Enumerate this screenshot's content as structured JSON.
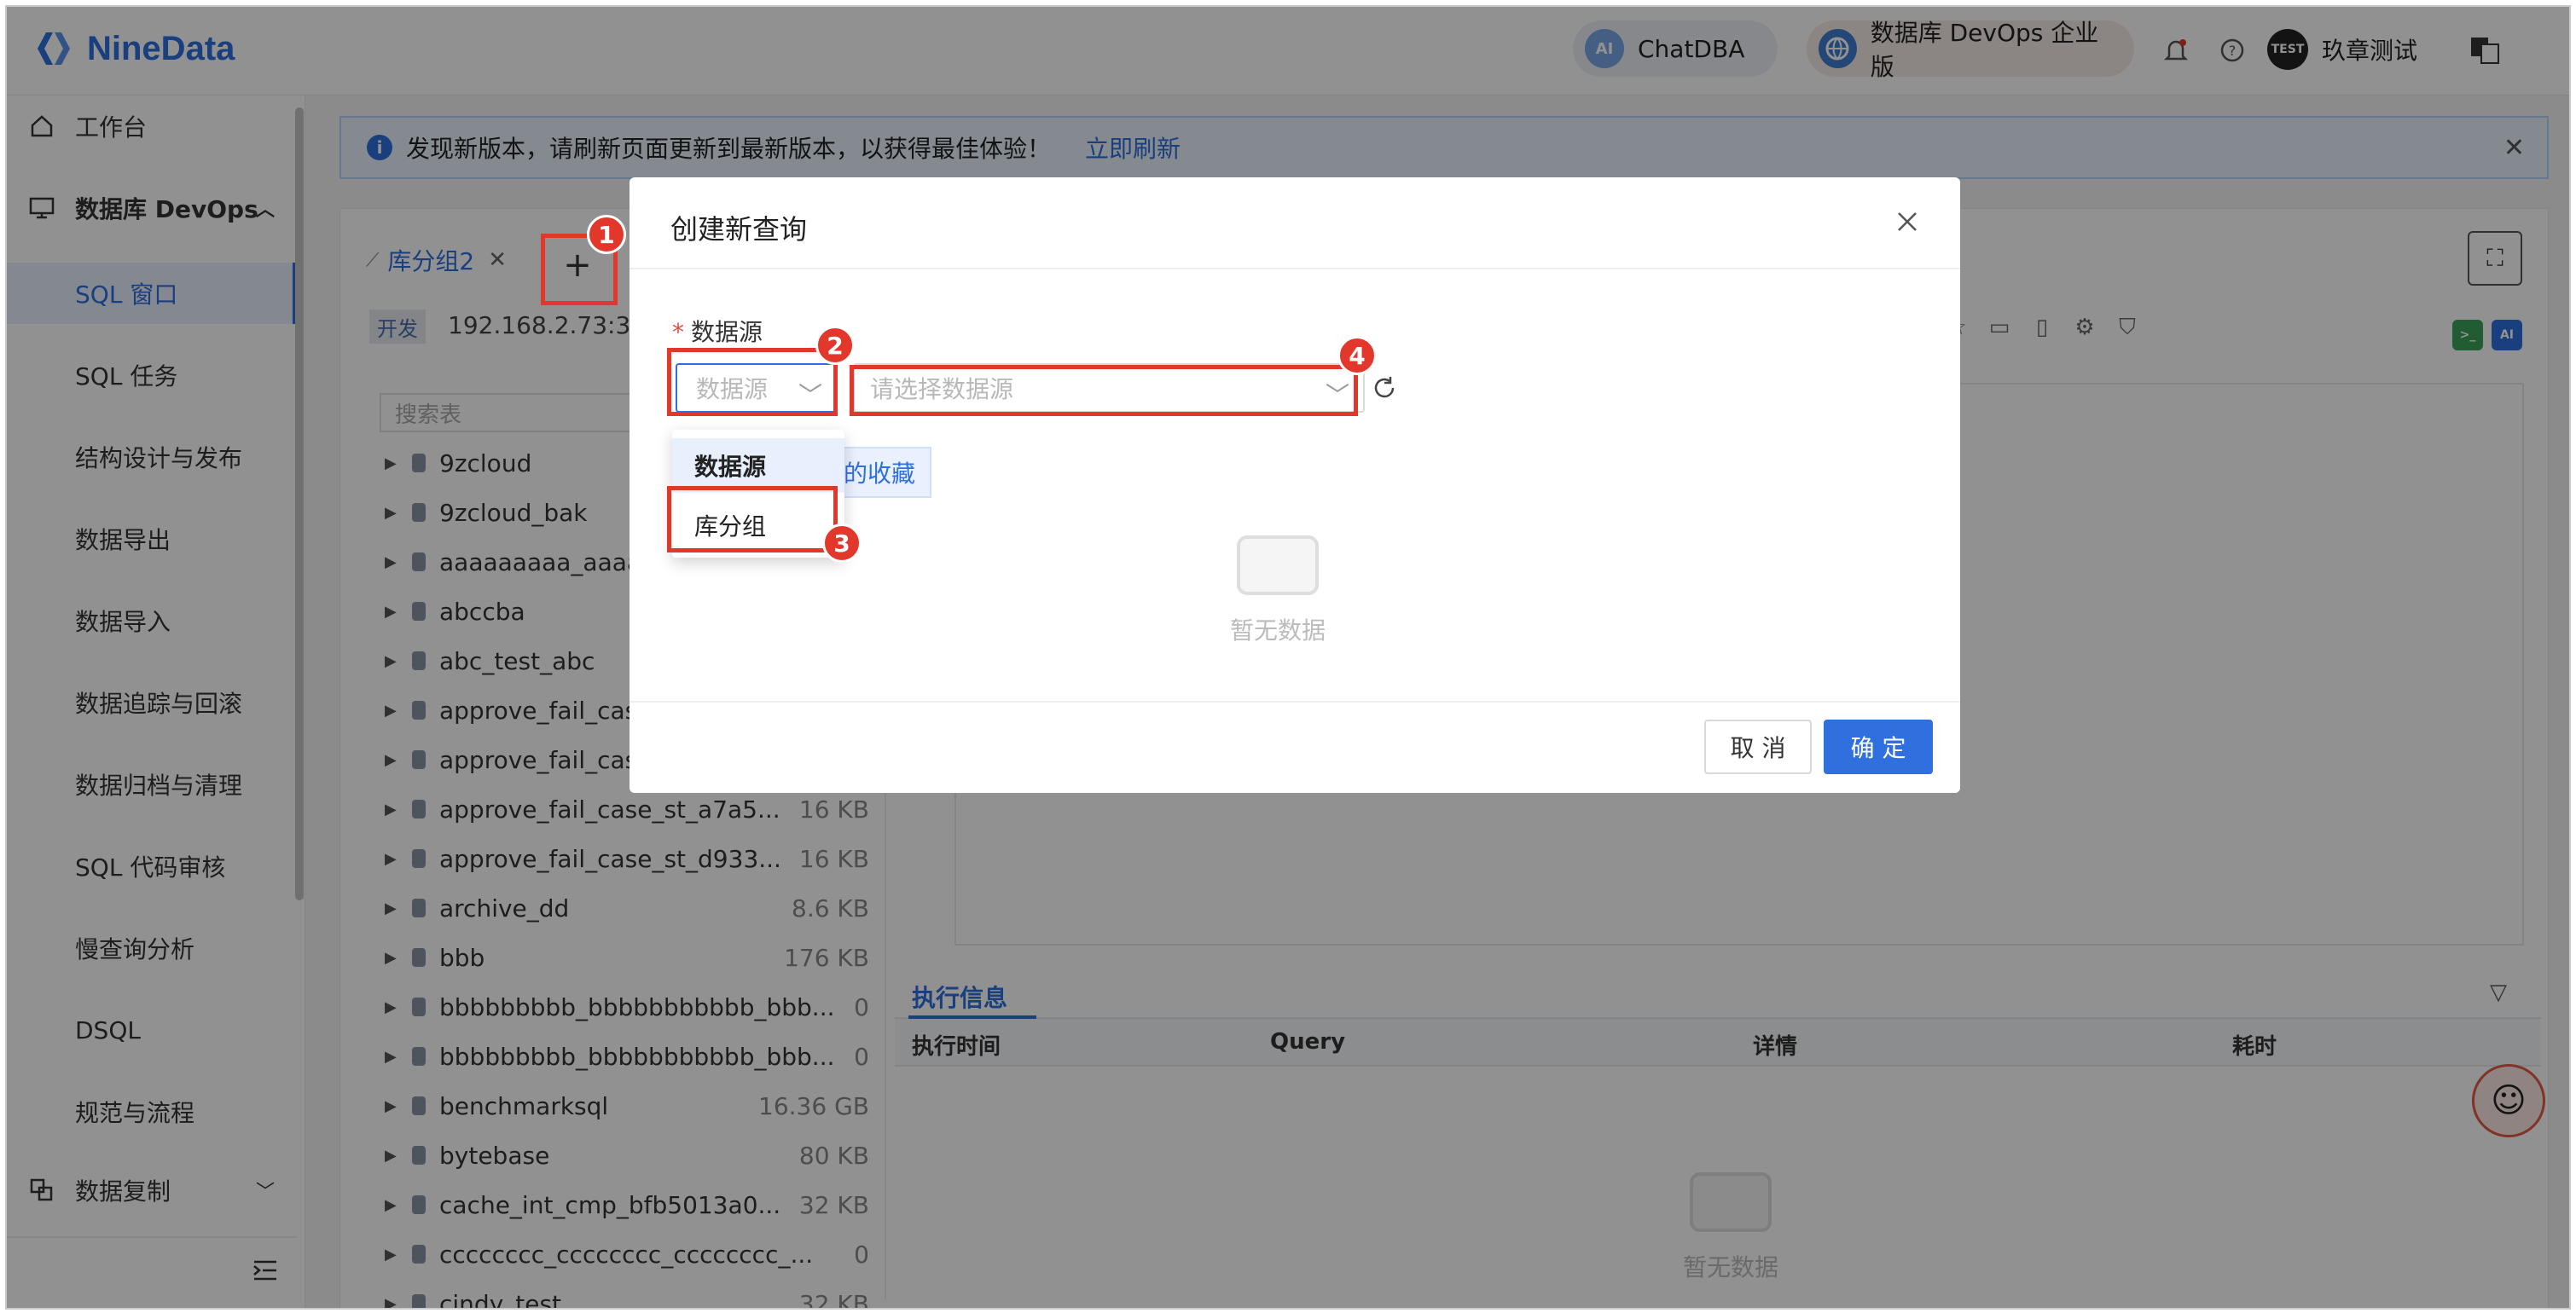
{
  "app": {
    "logo_text": "NineData",
    "chatdba_label": "ChatDBA",
    "devops_edition_label": "数据库 DevOps 企业版",
    "user_name": "玖章测试",
    "user_avatar_text": "TEST",
    "brand_color": "#2f6fde"
  },
  "sidebar": {
    "workbench": "工作台",
    "devops_group": "数据库 DevOps",
    "items": [
      {
        "label": "SQL 窗口",
        "active": true
      },
      {
        "label": "SQL 任务"
      },
      {
        "label": "结构设计与发布"
      },
      {
        "label": "数据导出"
      },
      {
        "label": "数据导入"
      },
      {
        "label": "数据追踪与回滚"
      },
      {
        "label": "数据归档与清理"
      },
      {
        "label": "SQL 代码审核"
      },
      {
        "label": "慢查询分析"
      },
      {
        "label": "DSQL"
      },
      {
        "label": "规范与流程"
      }
    ],
    "replication": "数据复制"
  },
  "notice": {
    "text": "发现新版本，请刷新页面更新到最新版本，以获得最佳体验！",
    "link": "立即刷新"
  },
  "workspace": {
    "tab_label": "库分组2",
    "env_tag": "开发",
    "host": "192.168.2.73:33",
    "search_placeholder": "搜索表",
    "databases": [
      {
        "name": "9zcloud",
        "size": ""
      },
      {
        "name": "9zcloud_bak",
        "size": ""
      },
      {
        "name": "aaaaaaaaa_aaaa",
        "size": ""
      },
      {
        "name": "abccba",
        "size": ""
      },
      {
        "name": "abc_test_abc",
        "size": ""
      },
      {
        "name": "approve_fail_cas",
        "size": ""
      },
      {
        "name": "approve_fail_cas",
        "size": ""
      },
      {
        "name": "approve_fail_case_st_a7a5...",
        "size": "16 KB"
      },
      {
        "name": "approve_fail_case_st_d933...",
        "size": "16 KB"
      },
      {
        "name": "archive_dd",
        "size": "8.6 KB"
      },
      {
        "name": "bbb",
        "size": "176 KB"
      },
      {
        "name": "bbbbbbbbb_bbbbbbbbbbb_bbb...",
        "size": "0"
      },
      {
        "name": "bbbbbbbbb_bbbbbbbbbbb_bbb...",
        "size": "0"
      },
      {
        "name": "benchmarksql",
        "size": "16.36 GB"
      },
      {
        "name": "bytebase",
        "size": "80 KB"
      },
      {
        "name": "cache_int_cmp_bfb5013a0...",
        "size": "32 KB"
      },
      {
        "name": "cccccccc_cccccccc_cccccccc_...",
        "size": "0"
      },
      {
        "name": "cindy_test",
        "size": "32 KB"
      }
    ],
    "exec_tab": "执行信息",
    "exec_columns": [
      "执行时间",
      "Query",
      "详情",
      "耗时"
    ],
    "empty_text": "暂无数据"
  },
  "modal": {
    "title": "创建新查询",
    "field_label": "数据源",
    "source_type_placeholder": "数据源",
    "datasource_placeholder": "请选择数据源",
    "favorites_tag": "我的收藏",
    "dropdown_options": [
      "数据源",
      "库分组"
    ],
    "empty_text": "暂无数据",
    "cancel": "取 消",
    "ok": "确 定"
  },
  "annotations": [
    "1",
    "2",
    "3",
    "4"
  ]
}
